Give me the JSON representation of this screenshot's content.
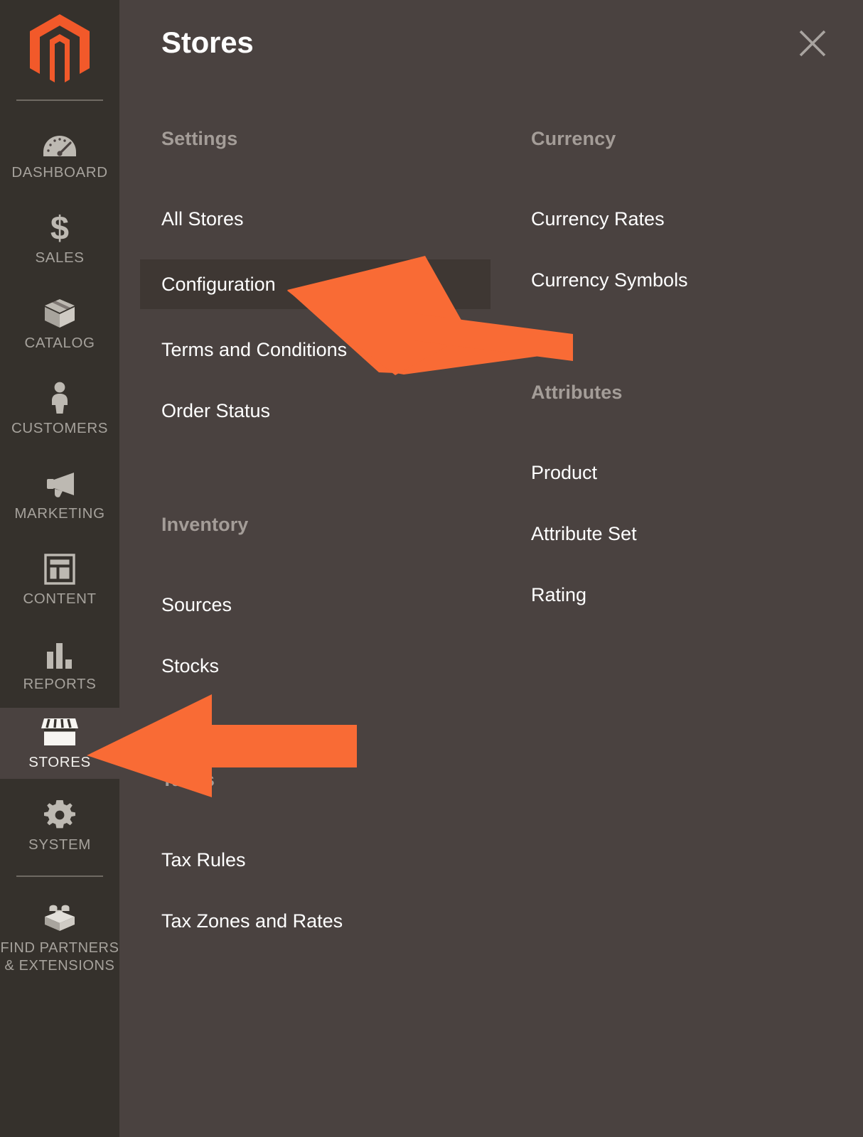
{
  "sidebar": {
    "logo": "magento-logo",
    "items": [
      {
        "label": "DASHBOARD",
        "icon": "dashboard-gauge-icon",
        "active": false
      },
      {
        "label": "SALES",
        "icon": "dollar-sign-icon",
        "active": false
      },
      {
        "label": "CATALOG",
        "icon": "box-icon",
        "active": false
      },
      {
        "label": "CUSTOMERS",
        "icon": "person-icon",
        "active": false
      },
      {
        "label": "MARKETING",
        "icon": "megaphone-icon",
        "active": false
      },
      {
        "label": "CONTENT",
        "icon": "layout-page-icon",
        "active": false
      },
      {
        "label": "REPORTS",
        "icon": "bar-chart-icon",
        "active": false
      },
      {
        "label": "STORES",
        "icon": "storefront-icon",
        "active": true
      },
      {
        "label": "SYSTEM",
        "icon": "gear-icon",
        "active": false
      },
      {
        "label": "FIND PARTNERS\n& EXTENSIONS",
        "label_line1": "FIND PARTNERS",
        "label_line2": "& EXTENSIONS",
        "icon": "puzzle-brick-icon",
        "active": false
      }
    ]
  },
  "panel": {
    "title": "Stores",
    "close_icon": "close-icon",
    "columns": [
      {
        "name": "left",
        "groups": [
          {
            "title": "Settings",
            "items": [
              {
                "label": "All Stores",
                "highlighted": false
              },
              {
                "label": "Configuration",
                "highlighted": true
              },
              {
                "label": "Terms and Conditions",
                "highlighted": false
              },
              {
                "label": "Order Status",
                "highlighted": false
              }
            ]
          },
          {
            "title": "Inventory",
            "items": [
              {
                "label": "Sources",
                "highlighted": false
              },
              {
                "label": "Stocks",
                "highlighted": false
              }
            ]
          },
          {
            "title": "Taxes",
            "items": [
              {
                "label": "Tax Rules",
                "highlighted": false
              },
              {
                "label": "Tax Zones and Rates",
                "highlighted": false
              }
            ]
          }
        ]
      },
      {
        "name": "right",
        "groups": [
          {
            "title": "Currency",
            "items": [
              {
                "label": "Currency Rates",
                "highlighted": false
              },
              {
                "label": "Currency Symbols",
                "highlighted": false
              }
            ]
          },
          {
            "title": "Attributes",
            "items": [
              {
                "label": "Product",
                "highlighted": false
              },
              {
                "label": "Attribute Set",
                "highlighted": false
              },
              {
                "label": "Rating",
                "highlighted": false
              }
            ]
          }
        ]
      }
    ]
  },
  "annotations": {
    "arrow_color": "#f96b35",
    "arrows": [
      {
        "name": "arrow-pointing-configuration",
        "points_at": "Configuration"
      },
      {
        "name": "arrow-pointing-stores",
        "points_at": "STORES"
      }
    ]
  },
  "colors": {
    "sidebar_bg": "#35312c",
    "panel_bg": "#4a4240",
    "highlight_bg": "#3e3733",
    "accent_orange": "#f96b35",
    "logo_orange": "#f2592a",
    "text_primary": "#ffffff",
    "text_muted": "#a49d98",
    "sidebar_label": "#a6a29c"
  }
}
